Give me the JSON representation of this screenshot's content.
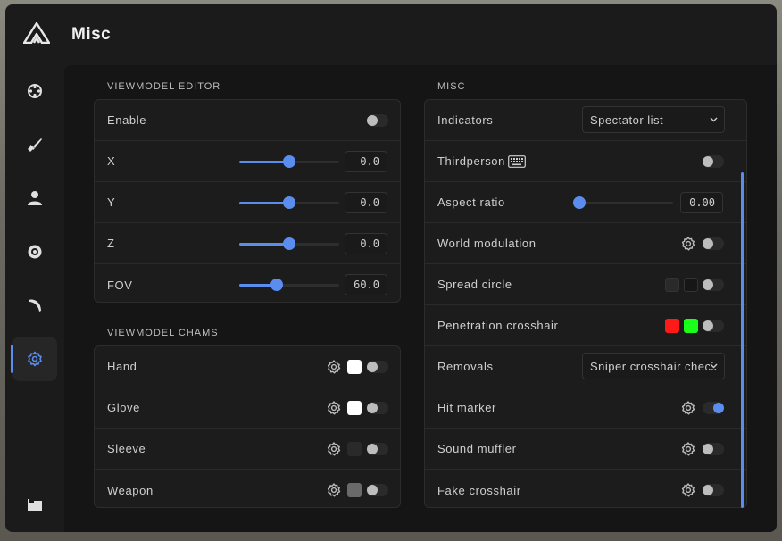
{
  "window": {
    "title": "Misc"
  },
  "sidebar": {
    "items": [
      {
        "name": "crosshair-icon"
      },
      {
        "name": "knife-icon"
      },
      {
        "name": "user-icon"
      },
      {
        "name": "eye-icon"
      },
      {
        "name": "sword-icon"
      },
      {
        "name": "gear-icon",
        "active": true
      },
      {
        "name": "folder-icon"
      }
    ]
  },
  "viewmodel_editor": {
    "title": "VIEWMODEL EDITOR",
    "enable_label": "Enable",
    "enable_on": false,
    "sliders": [
      {
        "label": "X",
        "value": "0.0",
        "fraction": 0.5
      },
      {
        "label": "Y",
        "value": "0.0",
        "fraction": 0.5
      },
      {
        "label": "Z",
        "value": "0.0",
        "fraction": 0.5
      },
      {
        "label": "FOV",
        "value": "60.0",
        "fraction": 0.36
      }
    ]
  },
  "viewmodel_chams": {
    "title": "VIEWMODEL CHAMS",
    "rows": [
      {
        "label": "Hand",
        "color": "#ffffff",
        "on": false
      },
      {
        "label": "Glove",
        "color": "#ffffff",
        "on": false
      },
      {
        "label": "Sleeve",
        "color": "#2a2a2a",
        "on": false
      },
      {
        "label": "Weapon",
        "color": "#6a6a6a",
        "on": false
      }
    ]
  },
  "misc": {
    "title": "MISC",
    "indicators": {
      "label": "Indicators",
      "value": "Spectator list"
    },
    "thirdperson": {
      "label": "Thirdperson",
      "on": false
    },
    "aspect_ratio": {
      "label": "Aspect ratio",
      "value": "0.00",
      "fraction": 0.0
    },
    "world_modulation": {
      "label": "World modulation",
      "on": false
    },
    "spread_circle": {
      "label": "Spread circle",
      "colors": [
        "#2a2a2a",
        "#161616"
      ],
      "on": false
    },
    "penetration_crosshair": {
      "label": "Penetration crosshair",
      "colors": [
        "#ff1a1a",
        "#1aff1a"
      ],
      "on": false
    },
    "removals": {
      "label": "Removals",
      "value": "Sniper crosshair check"
    },
    "hit_marker": {
      "label": "Hit marker",
      "on": true
    },
    "sound_muffler": {
      "label": "Sound muffler",
      "on": false
    },
    "fake_crosshair": {
      "label": "Fake crosshair",
      "on": false
    }
  },
  "colors": {
    "accent": "#5b8def",
    "background": "#1b1b1b",
    "panel": "#1c1c1c"
  }
}
